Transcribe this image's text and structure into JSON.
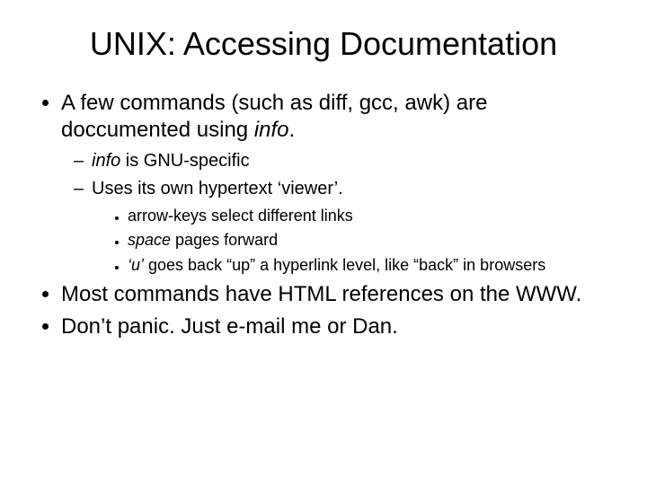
{
  "title": "UNIX: Accessing Documentation",
  "b1": {
    "pre": "A few commands (such as diff, gcc, awk) are doccumented using ",
    "em": "info",
    "post": "."
  },
  "b1s1": {
    "em": "info",
    "post": " is GNU-specific"
  },
  "b1s2": "Uses its own hypertext ‘viewer’.",
  "b1s2a": "arrow-keys select different links",
  "b1s2b": {
    "em": "space",
    "post": " pages forward"
  },
  "b1s2c": {
    "em": "‘u’",
    "post": " goes back “up” a hyperlink level, like “back” in browsers"
  },
  "b2": "Most commands have HTML references on the WWW.",
  "b3": "Don’t panic.  Just e-mail me or Dan."
}
